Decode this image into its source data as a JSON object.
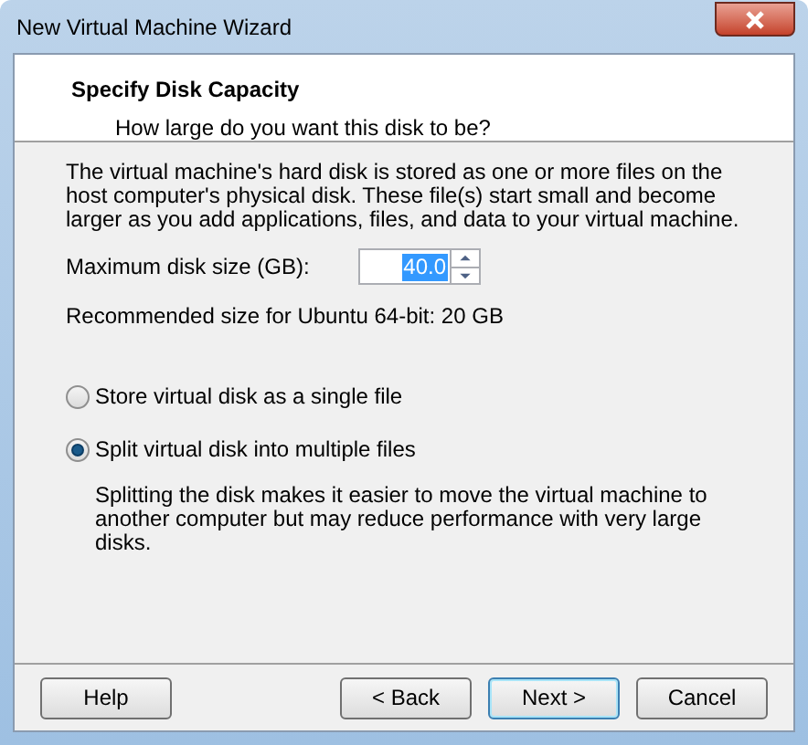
{
  "window": {
    "title": "New Virtual Machine Wizard"
  },
  "header": {
    "title": "Specify Disk Capacity",
    "subtitle": "How large do you want this disk to be?"
  },
  "description": "The virtual machine's hard disk is stored as one or more files on the host computer's physical disk. These file(s) start small and become larger as you add applications, files, and data to your virtual machine.",
  "disk_size": {
    "label": "Maximum disk size (GB):",
    "value": "40.0"
  },
  "recommendation": "Recommended size for Ubuntu 64-bit: 20 GB",
  "options": [
    {
      "label": "Store virtual disk as a single file",
      "selected": false
    },
    {
      "label": "Split virtual disk into multiple files",
      "selected": true
    }
  ],
  "split_note": "Splitting the disk makes it easier to move the virtual machine to another computer but may reduce performance with very large disks.",
  "buttons": [
    {
      "label": "Help",
      "kind": "help",
      "default": false
    },
    {
      "label": "< Back",
      "kind": "nav",
      "default": false
    },
    {
      "label": "Next >",
      "kind": "nav",
      "default": true
    },
    {
      "label": "Cancel",
      "kind": "nav",
      "default": false
    }
  ]
}
